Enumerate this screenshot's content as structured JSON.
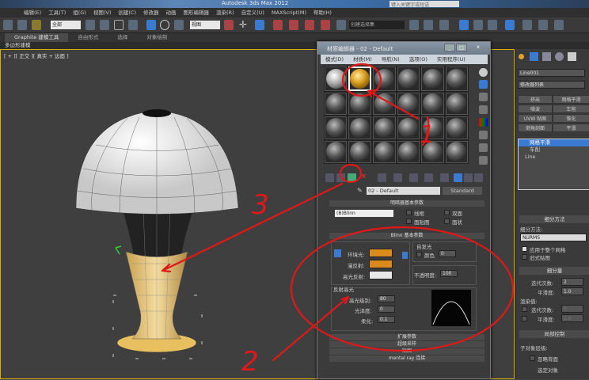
{
  "app": {
    "title": "Autodesk 3ds Max 2012",
    "search_placeholder": "键入关键字或短语"
  },
  "menu": [
    "编辑(E)",
    "工具(T)",
    "组(G)",
    "视图(V)",
    "创建(C)",
    "修改器",
    "动画",
    "图形编辑器",
    "渲染(R)",
    "自定义(U)",
    "MAXScript(M)",
    "帮助(H)"
  ],
  "toolbar": {
    "selection_filter": "全部",
    "ref_coord": "视图",
    "named_sel": "创建选择集"
  },
  "ribbon": {
    "tabs": [
      "Graphite 建模工具",
      "自由形式",
      "选择",
      "对象绘制"
    ],
    "active": 0,
    "panel": "多边形建模"
  },
  "viewport": {
    "label": "[ + ][ 正交 ][ 真实 + 边面 ]"
  },
  "material_editor": {
    "title": "材质编辑器 - 02 - Default",
    "menu": [
      "模式(D)",
      "材质(M)",
      "导航(N)",
      "选项(O)",
      "实用程序(U)"
    ],
    "material_name": "02 - Default",
    "material_type": "Standard",
    "shader_rollout": "明暗器基本参数",
    "shader": "(B)Blinn",
    "shader_options": [
      "线框",
      "双面",
      "面贴图",
      "面状"
    ],
    "blinn_rollout": "Blinn 基本参数",
    "self_illum": {
      "label": "自发光",
      "color_label": "颜色",
      "value": "0"
    },
    "ambient_label": "环境光:",
    "diffuse_label": "漫反射:",
    "specular_label": "高光反射:",
    "ambient_color": "#d98a1a",
    "diffuse_color": "#d98a1a",
    "specular_color": "#e8e8e8",
    "opacity": {
      "label": "不透明度:",
      "value": "100"
    },
    "spec_group": "反射高光",
    "spec_level": {
      "label": "高光级别:",
      "value": "80"
    },
    "glossiness": {
      "label": "光泽度:",
      "value": "0"
    },
    "soften": {
      "label": "柔化:",
      "value": "0.1"
    },
    "collapsed_rollouts": [
      "扩展参数",
      "超级采样",
      "贴图",
      "mental ray 连接"
    ]
  },
  "command_panel": {
    "object_name": "Line001",
    "modifier_list": "修改器列表",
    "mod_buttons": [
      "挤出",
      "网格平滑",
      "噪波",
      "车削",
      "UVW 贴图",
      "锥化",
      "倒角剖面",
      "平滑"
    ],
    "stack": [
      "网格平滑",
      "车削",
      "Line"
    ],
    "subdiv_method_rollout": "细分方法",
    "subdiv_method_label": "细分方法:",
    "subdiv_method": "NURMS",
    "apply_whole": "应用于整个网格",
    "old_map": "旧式贴图",
    "subdiv_amount_rollout": "细分量",
    "iterations": {
      "label": "迭代次数:",
      "value": "2"
    },
    "smoothness": {
      "label": "平滑度:",
      "value": "1.0"
    },
    "render_values": "渲染值:",
    "render_iterations": {
      "label": "迭代次数:",
      "value": "0"
    },
    "render_smoothness": {
      "label": "平滑度:",
      "value": "1.0"
    },
    "local_control_rollout": "局部控制",
    "sub_level": "子对象层级:",
    "ignore_backface": "忽略背面",
    "selected": "选定对象"
  },
  "annotations": [
    "1",
    "2",
    "3"
  ],
  "annotation_color": "#e01818"
}
